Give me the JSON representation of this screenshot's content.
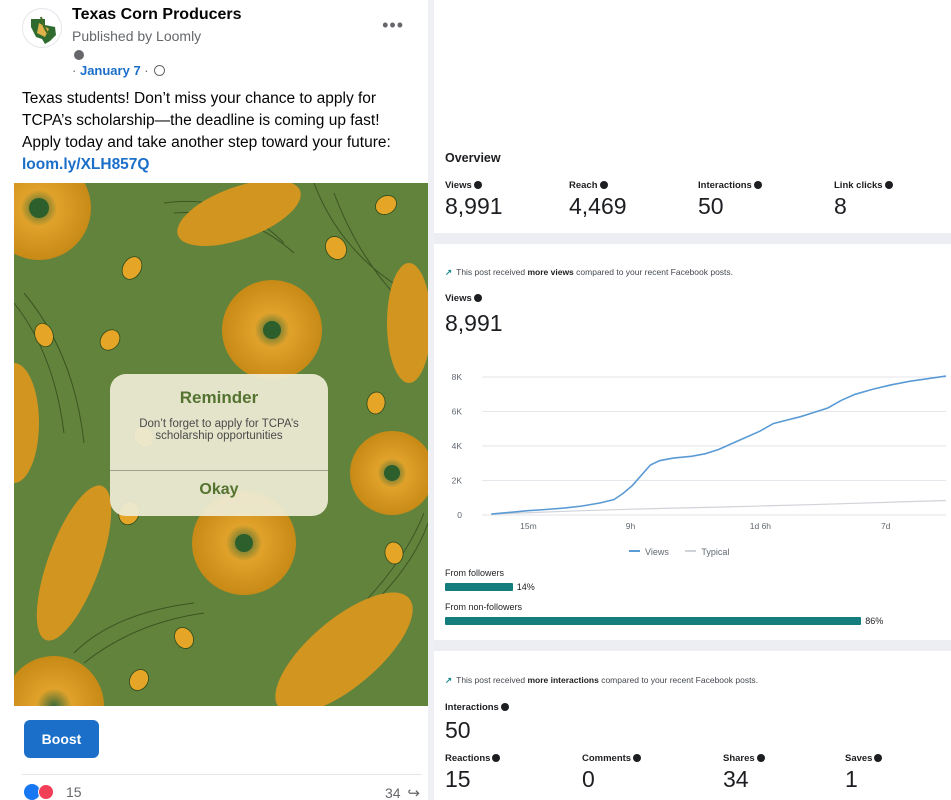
{
  "post": {
    "page_name": "Texas Corn Producers",
    "published_by": "Published by Loomly",
    "date": "January 7",
    "date_prefix": "·",
    "date_suffix": "·",
    "more_label": "•••",
    "text": "Texas students! Don’t miss your chance to apply for TCPA’s scholarship—the deadline is coming up fast! Apply today and take another step toward your future:",
    "link": "loom.ly/XLH857Q",
    "image": {
      "reminder_title": "Reminder",
      "reminder_body": "Don’t forget to apply for TCPA’s scholarship opportunities",
      "reminder_button": "Okay"
    },
    "boost_label": "Boost",
    "reaction_count": "15",
    "share_count": "34",
    "colors": {
      "link": "#1b6fc9",
      "image_bg": "#62833c",
      "kernel": "#d79a1d"
    }
  },
  "insights": {
    "overview_title": "Overview",
    "overview_metrics": [
      {
        "label": "Views",
        "value": "8,991"
      },
      {
        "label": "Reach",
        "value": "4,469"
      },
      {
        "label": "Interactions",
        "value": "50"
      },
      {
        "label": "Link clicks",
        "value": "8"
      }
    ],
    "views_note": {
      "prefix": "This post received",
      "bold": "more views",
      "suffix": "compared to your recent Facebook posts."
    },
    "views_label": "Views",
    "views_value": "8,991",
    "chart_data": {
      "type": "line",
      "x_ticks": [
        "15m",
        "9h",
        "1d 6h",
        "7d"
      ],
      "y_ticks": [
        "8K",
        "6K",
        "4K",
        "2K",
        "0"
      ],
      "ylim": [
        0,
        8000
      ],
      "grid": true,
      "legend_position": "bottom",
      "series": [
        {
          "name": "Views",
          "color": "#5b9bd5",
          "points": [
            [
              0,
              50
            ],
            [
              0.04,
              150
            ],
            [
              0.08,
              250
            ],
            [
              0.12,
              320
            ],
            [
              0.16,
              400
            ],
            [
              0.2,
              520
            ],
            [
              0.24,
              700
            ],
            [
              0.27,
              900
            ],
            [
              0.29,
              1250
            ],
            [
              0.31,
              1700
            ],
            [
              0.33,
              2300
            ],
            [
              0.35,
              2900
            ],
            [
              0.37,
              3150
            ],
            [
              0.4,
              3300
            ],
            [
              0.44,
              3400
            ],
            [
              0.47,
              3550
            ],
            [
              0.5,
              3800
            ],
            [
              0.53,
              4150
            ],
            [
              0.56,
              4500
            ],
            [
              0.59,
              4850
            ],
            [
              0.62,
              5300
            ],
            [
              0.65,
              5500
            ],
            [
              0.68,
              5700
            ],
            [
              0.71,
              5950
            ],
            [
              0.74,
              6200
            ],
            [
              0.77,
              6650
            ],
            [
              0.8,
              7000
            ],
            [
              0.84,
              7300
            ],
            [
              0.88,
              7550
            ],
            [
              0.92,
              7750
            ],
            [
              0.96,
              7900
            ],
            [
              1,
              8050
            ]
          ]
        },
        {
          "name": "Typical",
          "color": "#d0d3d8",
          "points": [
            [
              0,
              50
            ],
            [
              0.1,
              150
            ],
            [
              0.2,
              250
            ],
            [
              0.3,
              330
            ],
            [
              0.4,
              400
            ],
            [
              0.5,
              460
            ],
            [
              0.6,
              530
            ],
            [
              0.7,
              600
            ],
            [
              0.8,
              680
            ],
            [
              0.9,
              760
            ],
            [
              1,
              840
            ]
          ]
        }
      ]
    },
    "followers": {
      "label": "From followers",
      "pct": "14%",
      "value": 0.14
    },
    "non_followers": {
      "label": "From non-followers",
      "pct": "86%",
      "value": 0.86
    },
    "interactions_note": {
      "prefix": "This post received",
      "bold": "more interactions",
      "suffix": "compared to your recent Facebook posts."
    },
    "interactions_label": "Interactions",
    "interactions_value": "50",
    "interaction_metrics": [
      {
        "label": "Reactions",
        "value": "15"
      },
      {
        "label": "Comments",
        "value": "0"
      },
      {
        "label": "Shares",
        "value": "34"
      },
      {
        "label": "Saves",
        "value": "1"
      }
    ],
    "colors": {
      "accent_bar": "#147d7d",
      "trend": "#1a8a8a",
      "band": "#eceef4"
    }
  }
}
